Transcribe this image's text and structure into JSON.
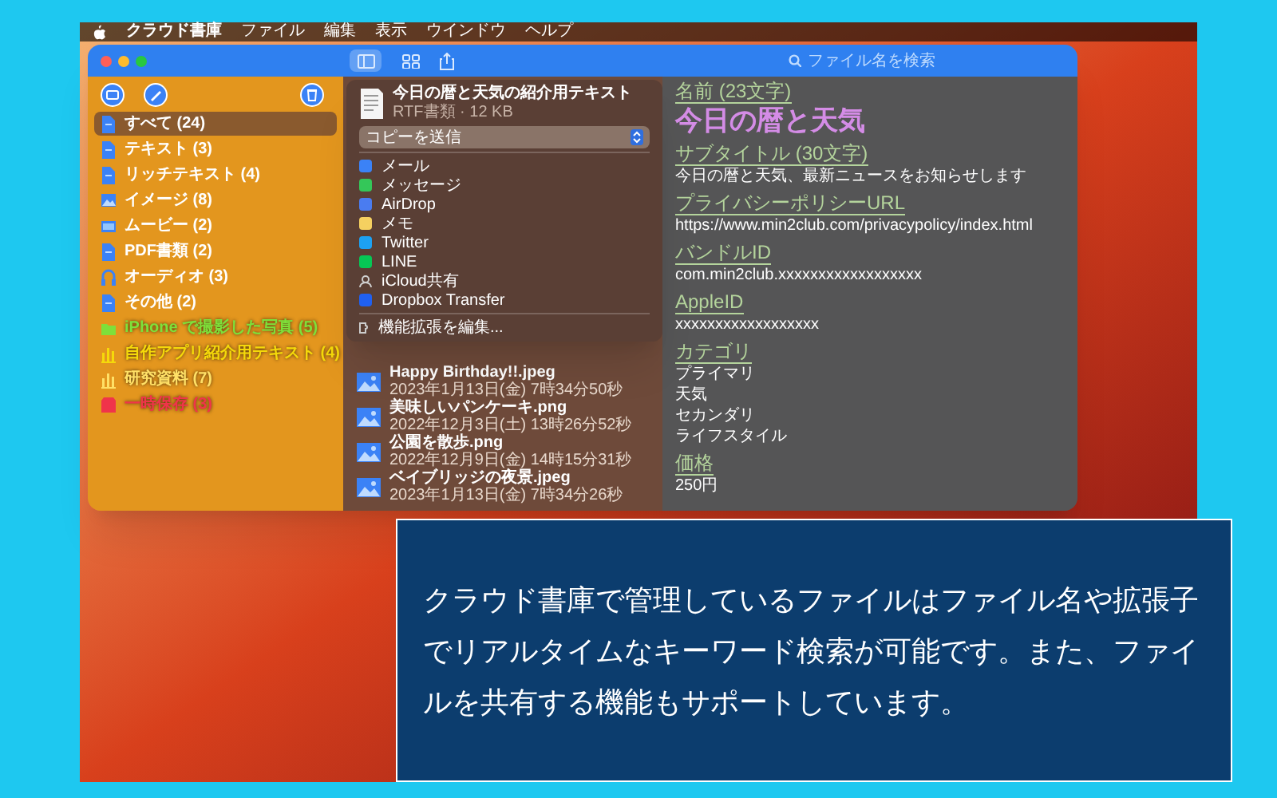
{
  "menu_bar": {
    "app_name": "クラウド書庫",
    "items": [
      "ファイル",
      "編集",
      "表示",
      "ウインドウ",
      "ヘルプ"
    ]
  },
  "toolbar": {
    "view_modes": [
      {
        "kind": "sidebar",
        "selected": true
      },
      {
        "kind": "grid",
        "selected": false
      }
    ],
    "search": {
      "placeholder": "ファイル名を検索"
    }
  },
  "sidebar": {
    "items": [
      {
        "label": "すべて (24)",
        "kind": "document",
        "selected": true
      },
      {
        "label": "テキスト (3)",
        "kind": "document",
        "selected": false
      },
      {
        "label": "リッチテキスト (4)",
        "kind": "document",
        "selected": false
      },
      {
        "label": "イメージ (8)",
        "kind": "image",
        "selected": false
      },
      {
        "label": "ムービー (2)",
        "kind": "movie",
        "selected": false
      },
      {
        "label": "PDF書類 (2)",
        "kind": "document",
        "selected": false
      },
      {
        "label": "オーディオ (3)",
        "kind": "audio",
        "selected": false
      },
      {
        "label": "その他 (2)",
        "kind": "document",
        "selected": false
      },
      {
        "label": "iPhone で撮影した写真 (5)",
        "kind": "folder",
        "color": "#7ee03a",
        "selected": false
      },
      {
        "label": "自作アプリ紹介用テキスト (4)",
        "kind": "chart",
        "color": "#f5d90a",
        "selected": false
      },
      {
        "label": "研究資料 (7)",
        "kind": "chart",
        "color": "#ffe066",
        "selected": false
      },
      {
        "label": "一時保存 (3)",
        "kind": "box",
        "color": "#f0344a",
        "selected": false
      }
    ]
  },
  "file_list": [
    {
      "name": "Happy Birthday!!.jpeg",
      "date": "2023年1月13日(金) 7時34分50秒"
    },
    {
      "name": "美味しいパンケーキ.png",
      "date": "2022年12月3日(土) 13時26分52秒"
    },
    {
      "name": "公園を散歩.png",
      "date": "2022年12月9日(金) 14時15分31秒"
    },
    {
      "name": "ベイブリッジの夜景.jpeg",
      "date": "2023年1月13日(金) 7時34分26秒"
    }
  ],
  "share_popup": {
    "file_title": "今日の暦と天気の紹介用テキスト",
    "file_meta": "RTF書類 · 12 KB",
    "action": "コピーを送信",
    "targets": [
      {
        "label": "メール",
        "kind": "mail"
      },
      {
        "label": "メッセージ",
        "kind": "message"
      },
      {
        "label": "AirDrop",
        "kind": "airdrop"
      },
      {
        "label": "メモ",
        "kind": "notes"
      },
      {
        "label": "Twitter",
        "kind": "twitter"
      },
      {
        "label": "LINE",
        "kind": "line"
      },
      {
        "label": "iCloud共有",
        "kind": "people"
      },
      {
        "label": "Dropbox Transfer",
        "kind": "dropbox"
      }
    ],
    "edit_extensions": "機能拡張を編集..."
  },
  "details": {
    "fields": [
      {
        "label": "名前 (23文字)",
        "kind": "title",
        "values": [
          "今日の暦と天気"
        ]
      },
      {
        "label": "サブタイトル (30文字)",
        "kind": "text",
        "values": [
          "今日の暦と天気、最新ニュースをお知らせします"
        ]
      },
      {
        "label": "プライバシーポリシーURL",
        "kind": "text",
        "values": [
          "https://www.min2club.com/privacypolicy/index.html"
        ]
      },
      {
        "label": "バンドルID",
        "kind": "text",
        "values": [
          "com.min2club.xxxxxxxxxxxxxxxxxx"
        ]
      },
      {
        "label": "AppleID",
        "kind": "text",
        "values": [
          "xxxxxxxxxxxxxxxxxx"
        ]
      },
      {
        "label": "カテゴリ",
        "kind": "text",
        "values": [
          "プライマリ",
          "天気",
          "セカンダリ",
          "ライフスタイル"
        ]
      },
      {
        "label": "価格",
        "kind": "text",
        "values": [
          "250円"
        ]
      }
    ]
  },
  "caption": "クラウド書庫で管理しているファイルはファイル名や拡張子でリアルタイムなキーワード検索が可能です。また、ファイルを共有する機能もサポートしています。"
}
